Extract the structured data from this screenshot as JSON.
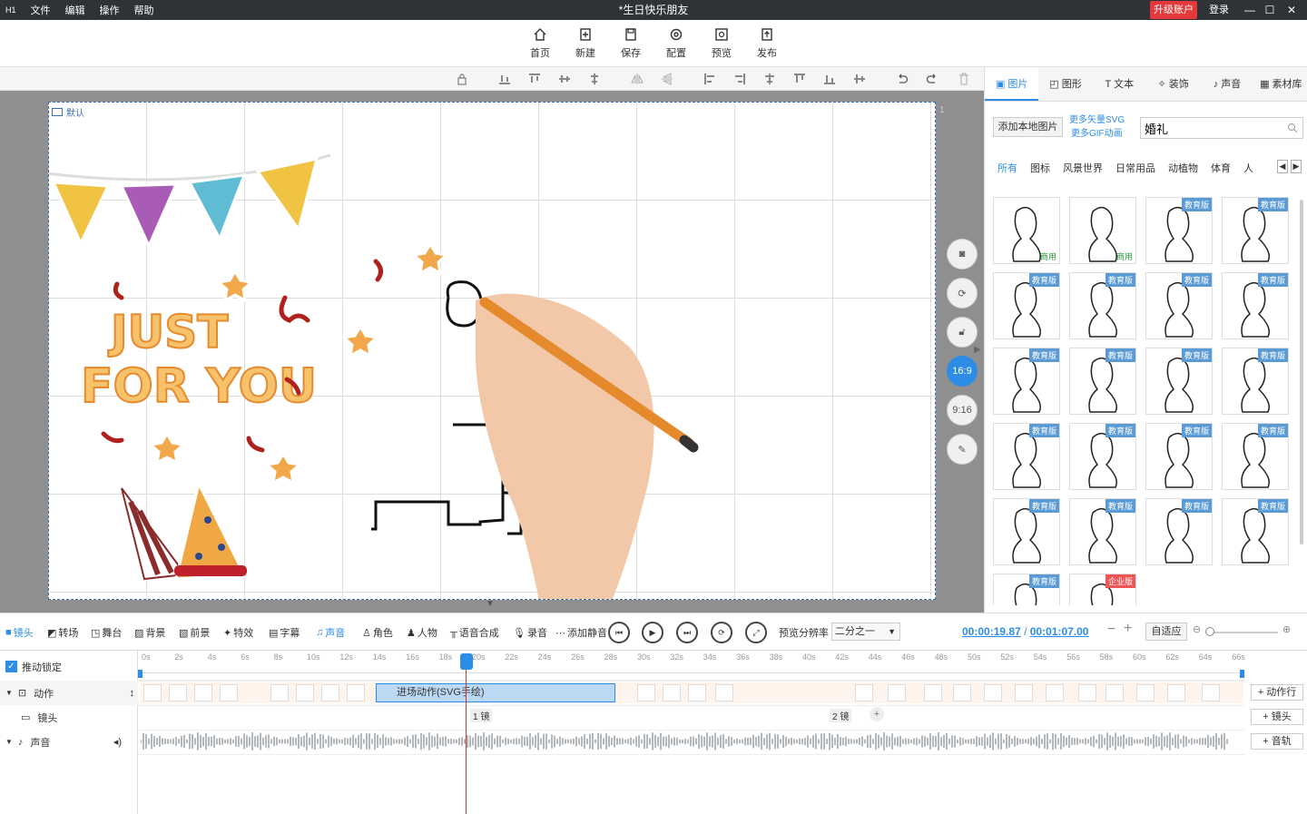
{
  "app": {
    "logo": "H1",
    "menu": [
      "文件",
      "编辑",
      "操作",
      "帮助"
    ],
    "title": "*生日快乐朋友",
    "upgrade": "升级账户",
    "login": "登录"
  },
  "toolbar": {
    "items": [
      "首页",
      "新建",
      "保存",
      "配置",
      "预览",
      "发布"
    ]
  },
  "canvas": {
    "label": "默认",
    "page": "1",
    "text": [
      "JUST",
      "FOR YOU"
    ]
  },
  "side_buttons": {
    "r169": "16:9",
    "r916": "9:16"
  },
  "panel": {
    "tabs": [
      "图片",
      "图形",
      "文本",
      "装饰",
      "声音",
      "素材库"
    ],
    "add_local": "添加本地图片",
    "more_svg": "更多矢量SVG",
    "more_gif": "更多GIF动画",
    "search_value": "婚礼",
    "categories": [
      "所有",
      "图标",
      "风景世界",
      "日常用品",
      "动植物",
      "体育",
      "人"
    ],
    "badges": {
      "com": "商用",
      "edu": "教育版",
      "ent": "企业版"
    }
  },
  "controls": {
    "buttons": [
      "镜头",
      "转场",
      "舞台",
      "背景",
      "前景",
      "特效",
      "字幕",
      "声音",
      "角色",
      "人物",
      "语音合成",
      "录音",
      "添加静音"
    ],
    "res_label": "预览分辨率",
    "res_value": "二分之一",
    "time_current": "00:00:19.87",
    "time_sep": "/",
    "time_total": "00:01:07.00",
    "fit": "自适应"
  },
  "timeline": {
    "lock_label": "推动锁定",
    "rows": [
      "动作",
      "镜头",
      "声音"
    ],
    "ticks": [
      "0s",
      "2s",
      "4s",
      "6s",
      "8s",
      "10s",
      "12s",
      "14s",
      "16s",
      "18s",
      "20s",
      "22s",
      "24s",
      "26s",
      "28s",
      "30s",
      "32s",
      "34s",
      "36s",
      "38s",
      "40s",
      "42s",
      "44s",
      "46s",
      "48s",
      "50s",
      "52s",
      "54s",
      "56s",
      "58s",
      "60s",
      "62s",
      "64s",
      "66s"
    ],
    "main_clip": "进场动作(SVG手绘)",
    "cam1": "1 镜",
    "cam2": "2 镜",
    "right_buttons": [
      "+ 动作行",
      "+ 镜头",
      "+ 音轨"
    ]
  }
}
